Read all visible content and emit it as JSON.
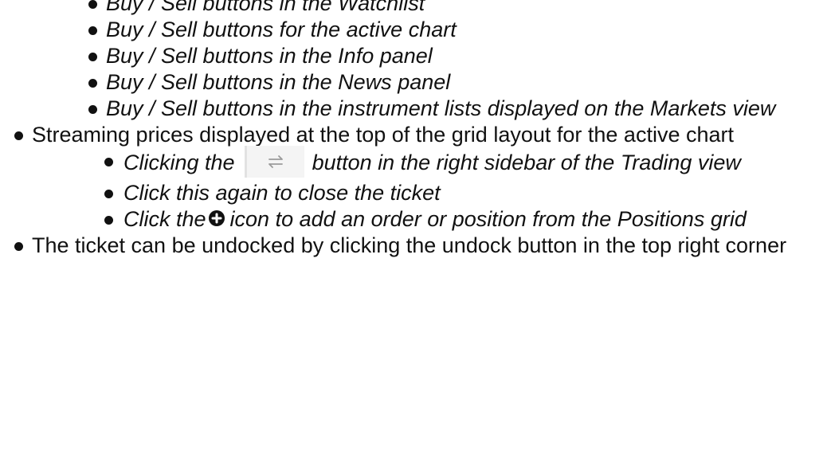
{
  "sub_list_1": [
    "Buy / Sell buttons in the Watchlist",
    "Buy / Sell buttons for the active chart",
    "Buy / Sell buttons in the Info panel",
    "Buy / Sell buttons in the News panel",
    "Buy / Sell buttons in the instrument lists displayed on the Markets view"
  ],
  "bullet_streaming": "Streaming prices displayed at the top of the grid layout for the active chart",
  "sub_list_2": {
    "item1_before": "Clicking the",
    "item1_after": "button in the right sidebar of the Trading view",
    "item1_icon": "swap-arrows-icon",
    "item2": "Click this again to close the ticket",
    "item3_before": "Click the",
    "item3_after": "icon to add an order or position from the Positions grid",
    "item3_icon": "plus-circle-icon"
  },
  "bullet_undock": "The ticket can be undocked by clicking the undock button in the top right corner",
  "colors": {
    "text": "#111111",
    "icon_button_bg": "#f4f4f4",
    "icon_button_border": "#e2e2e2",
    "icon_arrow": "#9a9a9a"
  }
}
